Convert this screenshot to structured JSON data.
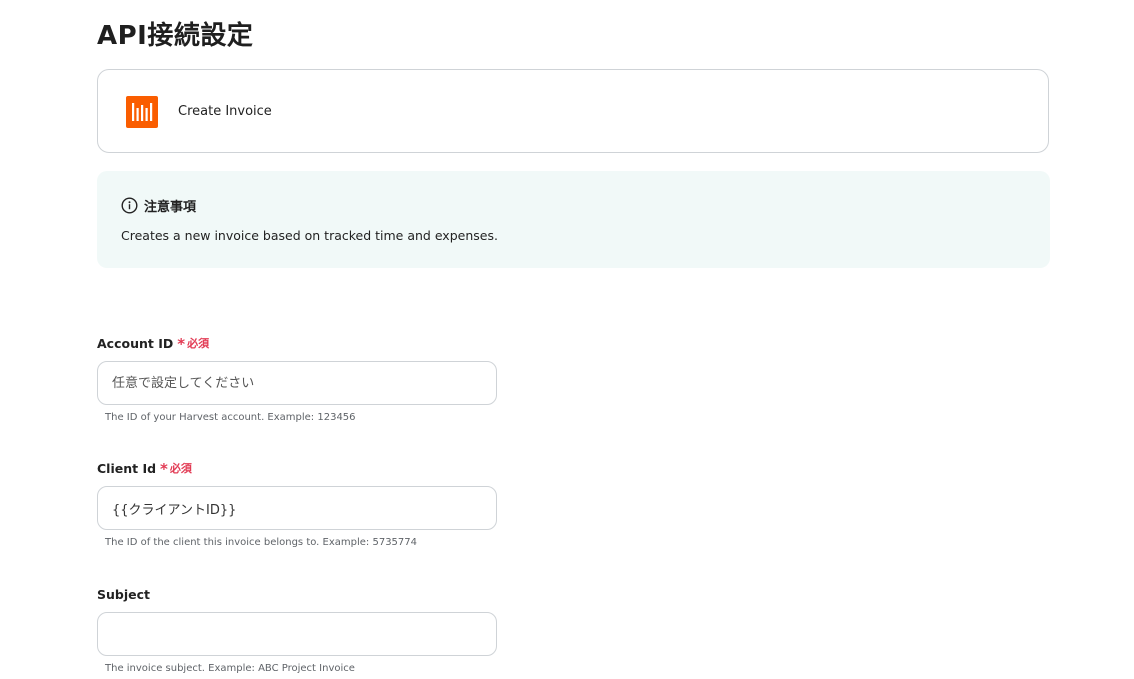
{
  "page": {
    "title": "API接続設定"
  },
  "action": {
    "name": "Create Invoice",
    "app_icon": "harvest-logo",
    "brand_color": "#fa5d00"
  },
  "notice": {
    "icon": "info-icon",
    "title": "注意事項",
    "text": "Creates a new invoice based on tracked time and expenses."
  },
  "form": {
    "required_label": "必須",
    "required_color": "#e23b54",
    "fields": [
      {
        "label": "Account ID",
        "required": true,
        "value": "",
        "placeholder": "任意で設定してください",
        "hint": "The ID of your Harvest account. Example: 123456"
      },
      {
        "label": "Client Id",
        "required": true,
        "value": "{{クライアントID}}",
        "placeholder": "",
        "hint": "The ID of the client this invoice belongs to. Example: 5735774"
      },
      {
        "label": "Subject",
        "required": false,
        "value": "",
        "placeholder": "",
        "hint": "The invoice subject. Example: ABC Project Invoice"
      }
    ]
  }
}
